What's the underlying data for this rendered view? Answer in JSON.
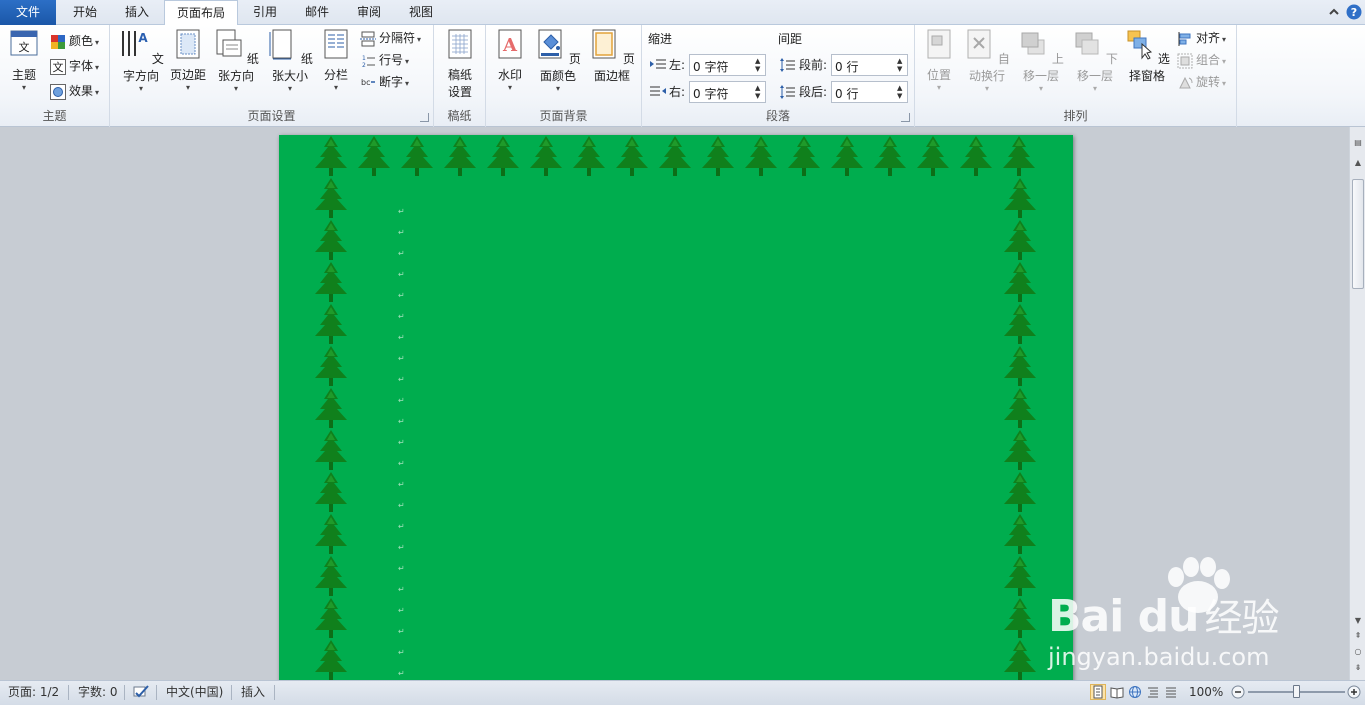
{
  "tabs": [
    {
      "id": "file",
      "label": "文件"
    },
    {
      "id": "home",
      "label": "开始"
    },
    {
      "id": "insert",
      "label": "插入"
    },
    {
      "id": "layout",
      "label": "页面布局"
    },
    {
      "id": "refs",
      "label": "引用"
    },
    {
      "id": "mail",
      "label": "邮件"
    },
    {
      "id": "review",
      "label": "审阅"
    },
    {
      "id": "view",
      "label": "视图"
    }
  ],
  "active_tab": "页面布局",
  "ribbon": {
    "theme": {
      "label": "主题",
      "themes_button": "主题",
      "colors": "颜色",
      "fonts": "字体",
      "effects": "效果"
    },
    "page_setup": {
      "label": "页面设置",
      "text_direction": "文字方向",
      "margins": "页边距",
      "orientation": "纸张方向",
      "size": "纸张大小",
      "columns": "分栏",
      "breaks": "分隔符",
      "line_numbers": "行号",
      "hyphenation": "断字"
    },
    "manuscript": {
      "label": "稿纸",
      "button_line1": "稿纸",
      "button_line2": "设置"
    },
    "page_background": {
      "label": "页面背景",
      "watermark": "水印",
      "page_color": "页面颜色",
      "page_borders": "页面边框"
    },
    "paragraph": {
      "label": "段落",
      "indent_title": "缩进",
      "spacing_title": "间距",
      "left_label": "左:",
      "left_value": "0 字符",
      "right_label": "右:",
      "right_value": "0 字符",
      "before_label": "段前:",
      "before_value": "0 行",
      "after_label": "段后:",
      "after_value": "0 行"
    },
    "arrange": {
      "label": "排列",
      "position": "位置",
      "wrap_text": "自动换行",
      "bring_forward": "上移一层",
      "send_backward": "下移一层",
      "selection_pane": "选择窗格",
      "align": "对齐",
      "group": "组合",
      "rotate": "旋转"
    }
  },
  "document": {
    "page_color": "#00AD4E",
    "border_art": "tree-border",
    "paragraph_mark": "↵"
  },
  "watermark": {
    "logo_text": "Bai  du",
    "brand_suffix": "经验",
    "site": "jingyan.baidu.com"
  },
  "status_bar": {
    "page": "页面: 1/2",
    "words": "字数: 0",
    "language": "中文(中国)",
    "mode": "插入",
    "zoom": "100%"
  },
  "icons": {
    "minimize_ribbon": "chevron-up-icon",
    "help": "help-icon"
  }
}
